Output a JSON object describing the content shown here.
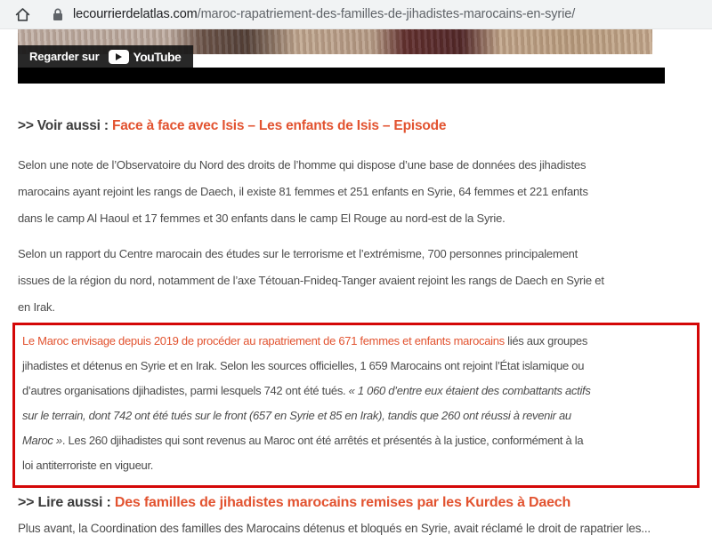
{
  "browser": {
    "url_domain": "lecourrierdelatlas.com",
    "url_path": "/maroc-rapatriement-des-familles-de-jihadistes-marocains-en-syrie/"
  },
  "video": {
    "watch_on_label": "Regarder sur",
    "brand_label": "YouTube"
  },
  "article": {
    "voir_aussi_prefix": ">> Voir aussi :",
    "voir_aussi_link": "Face à face avec Isis – Les enfants de Isis – Episode",
    "paragraph1": "Selon une note de l’Observatoire du Nord des droits de l’homme qui dispose d’une base de données des jihadistes\nmarocains ayant rejoint les rangs de Daech, il existe 81 femmes et 251 enfants en Syrie, 64 femmes et 221 enfants\ndans le camp Al Haoul et 17 femmes et 30 enfants dans le camp El Rouge au nord-est de la Syrie.",
    "paragraph2": "Selon un rapport du Centre marocain des études sur le terrorisme et l’extrémisme, 700 personnes principalement\nissues de la région du nord, notamment de l’axe Tétouan-Fnideq-Tanger avaient rejoint les rangs de Daech en Syrie et\nen Irak.",
    "highlight": {
      "link_text": "Le Maroc envisage depuis 2019 de procéder au rapatriement de 671 femmes et enfants marocains",
      "after_link": " liés aux groupes\njihadistes et détenus en Syrie et en Irak. Selon les sources officielles, 1 659 Marocains ont rejoint l’État islamique ou\nd’autres organisations djihadistes, parmi lesquels 742 ont été tués. ",
      "quote_italic": "« 1 060 d’entre eux étaient des combattants actifs\nsur le terrain, dont 742 ont été tués sur le front (657 en Syrie et 85 en Irak), tandis que 260 ont réussi à revenir au\nMaroc »",
      "after_quote": ". Les 260 djihadistes qui sont revenus au Maroc ont été arrêtés et présentés à la justice, conformément à la\nloi antiterroriste en vigueur."
    },
    "lire_aussi_prefix": ">> Lire aussi :",
    "lire_aussi_link": "Des familles de jihadistes marocains remises par les Kurdes à Daech",
    "partial_bottom_line": "Plus avant, la Coordination des familles des Marocains détenus et bloqués en Syrie, avait réclamé le droit de rapatrier les..."
  },
  "colors": {
    "accent_link": "#e25330",
    "highlight_border": "#d40707",
    "address_bar_bg": "#f1f3f4",
    "body_text": "#4c4c4c"
  }
}
